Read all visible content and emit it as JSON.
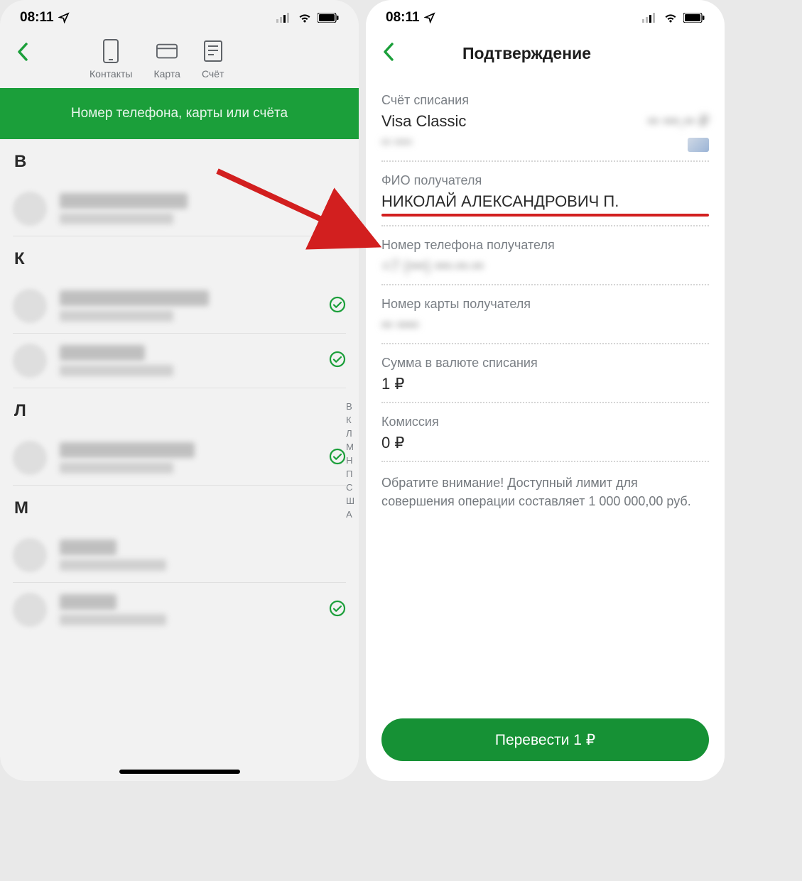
{
  "status": {
    "time": "08:11"
  },
  "left": {
    "tabs": {
      "contacts": "Контакты",
      "card": "Карта",
      "account": "Счёт"
    },
    "search_placeholder": "Номер телефона, карты или счёта",
    "sections": {
      "b": "В",
      "k": "К",
      "l": "Л",
      "m": "М"
    },
    "alpha_index": [
      "В",
      "К",
      "Л",
      "М",
      "Н",
      "П",
      "С",
      "Ш",
      "А"
    ]
  },
  "right": {
    "title": "Подтверждение",
    "account": {
      "label": "Счёт списания",
      "name": "Visa Classic",
      "balance_masked": "•• •••,•• ₽",
      "number_masked": "•• ••••"
    },
    "recipient_label": "ФИО получателя",
    "recipient_name": "НИКОЛАЙ АЛЕКСАНДРОВИЧ П.",
    "recipient_phone_label": "Номер телефона получателя",
    "recipient_phone_masked": "+7 (•••) •••-••-••",
    "recipient_card_label": "Номер карты получателя",
    "recipient_card_masked": "•• ••••",
    "amount_label": "Сумма в валюте списания",
    "amount_value": "1 ₽",
    "fee_label": "Комиссия",
    "fee_value": "0 ₽",
    "notice": "Обратите внимание! Доступный лимит для совершения операции составляет 1 000 000,00 руб.",
    "button": "Перевести 1 ₽"
  }
}
